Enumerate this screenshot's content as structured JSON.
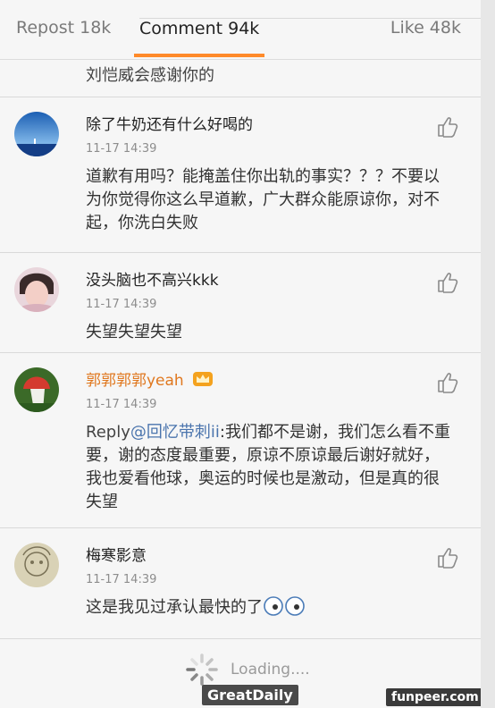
{
  "tabs": {
    "repost": "Repost 18k",
    "comment": "Comment 94k",
    "like": "Like 48k"
  },
  "carry_text": "刘恺威会感谢你的",
  "comments": [
    {
      "name": "除了牛奶还有什么好喝的",
      "time": "11-17 14:39",
      "text": "道歉有用吗？能掩盖住你出轨的事实？？？不要以为你觉得你这么早道歉，广大群众能原谅你，对不起，你洗白失败"
    },
    {
      "name": "没头脑也不高兴kkk",
      "time": "11-17 14:39",
      "text": "失望失望失望"
    },
    {
      "name": "郭郭郭郭yeah",
      "time": "11-17 14:39",
      "reply_prefix": "Reply",
      "mention": "@回忆带刺ii",
      "text": ":我们都不是谢，我们怎么看不重要，谢的态度最重要，原谅不原谅最后谢好就好，我也爱看他球，奥运的时候也是激动，但是真的很失望"
    },
    {
      "name": "梅寒影意",
      "time": "11-17 14:39",
      "text": "这是我见过承认最快的了"
    }
  ],
  "loading": "Loading....",
  "watermarks": {
    "left": "GreatDaily",
    "right": "funpeer.com"
  },
  "colors": {
    "accent": "#ff8a2a",
    "username_vip": "#e0781f",
    "mention": "#4a74ad"
  }
}
